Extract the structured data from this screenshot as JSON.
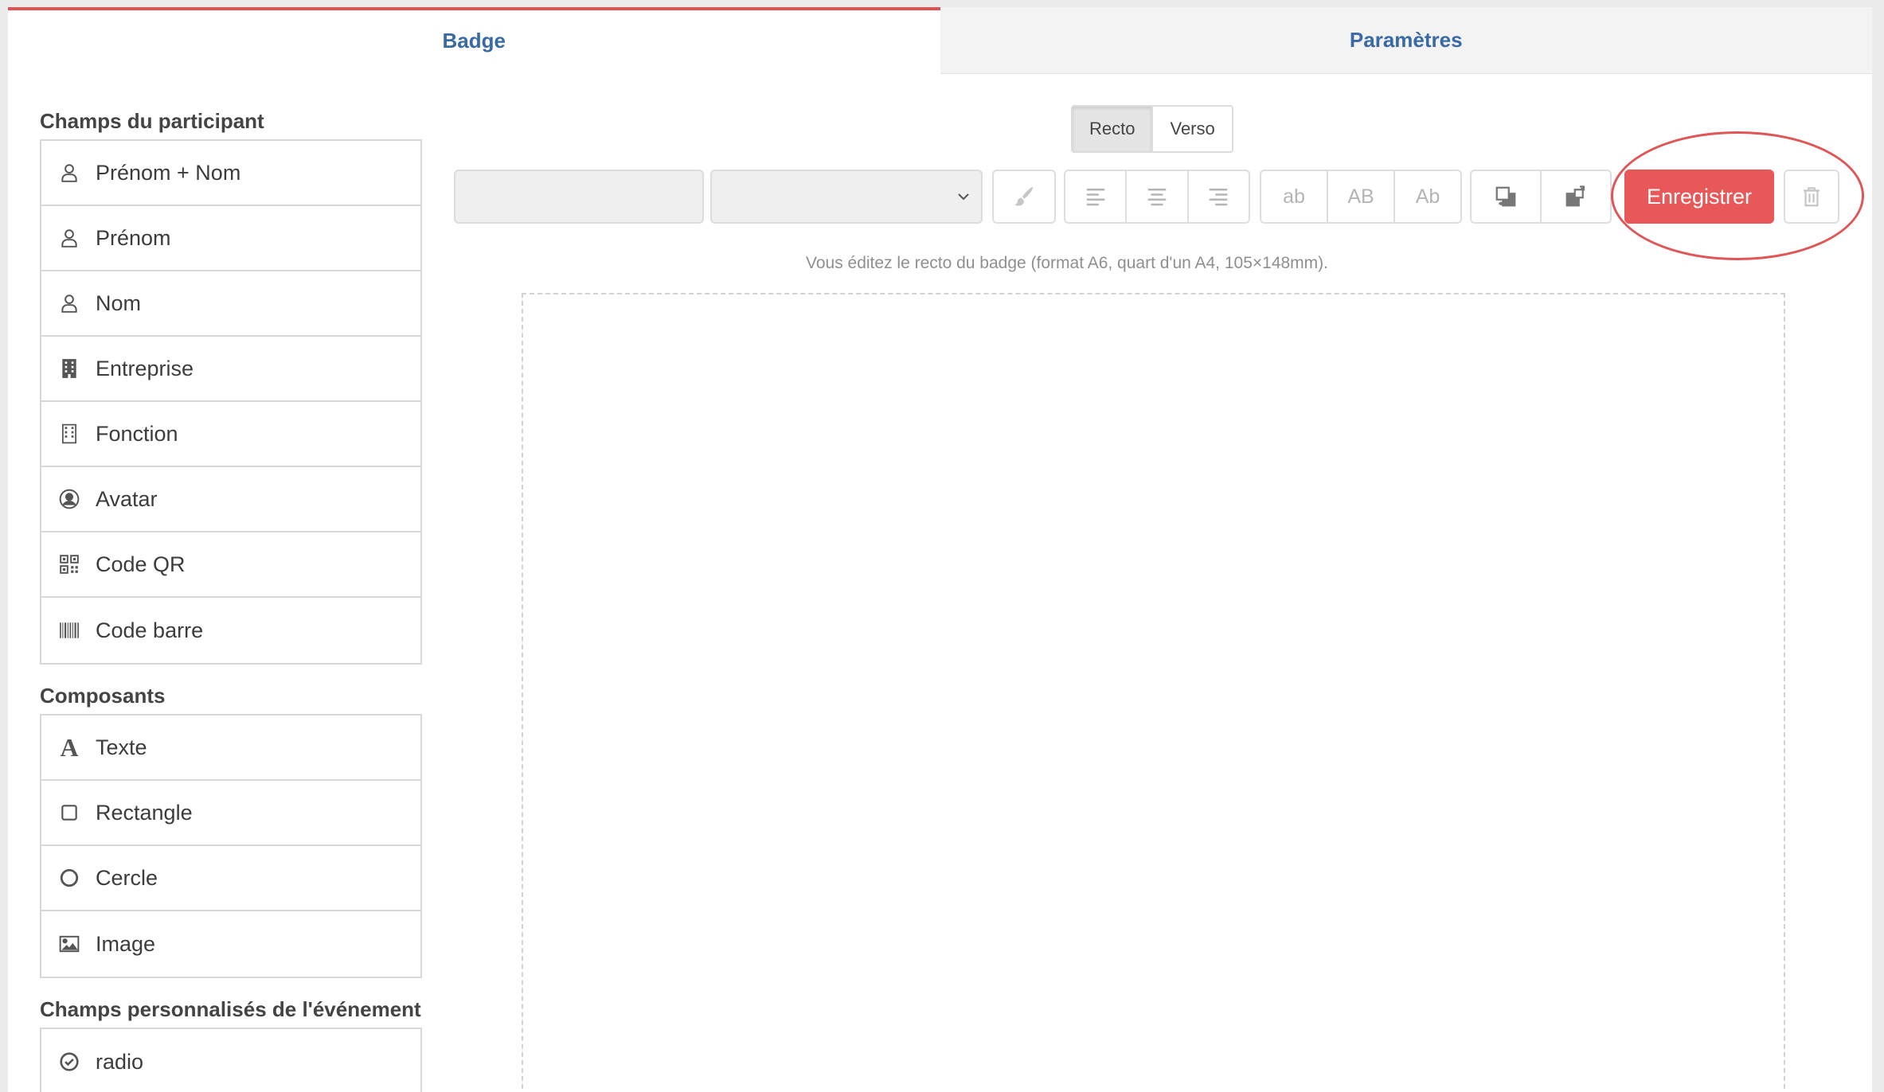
{
  "tabs": [
    {
      "label": "Badge",
      "active": true
    },
    {
      "label": "Paramètres",
      "active": false
    }
  ],
  "sidebar": {
    "participant_title": "Champs du participant",
    "participant_fields": [
      {
        "label": "Prénom + Nom",
        "icon": "user-icon"
      },
      {
        "label": "Prénom",
        "icon": "user-icon"
      },
      {
        "label": "Nom",
        "icon": "user-icon"
      },
      {
        "label": "Entreprise",
        "icon": "building-icon"
      },
      {
        "label": "Fonction",
        "icon": "building-outline-icon"
      },
      {
        "label": "Avatar",
        "icon": "avatar-icon"
      },
      {
        "label": "Code QR",
        "icon": "qrcode-icon"
      },
      {
        "label": "Code barre",
        "icon": "barcode-icon"
      }
    ],
    "components_title": "Composants",
    "components": [
      {
        "label": "Texte",
        "icon": "text-icon"
      },
      {
        "label": "Rectangle",
        "icon": "square-icon"
      },
      {
        "label": "Cercle",
        "icon": "circle-icon"
      },
      {
        "label": "Image",
        "icon": "image-icon"
      }
    ],
    "custom_title": "Champs personnalisés de l'événement",
    "custom_fields": [
      {
        "label": "radio",
        "icon": "check-circle-icon"
      }
    ]
  },
  "editor": {
    "side_toggle": [
      "Recto",
      "Verso"
    ],
    "active_side": "Recto",
    "case_buttons": [
      "ab",
      "AB",
      "Ab"
    ],
    "save_label": "Enregistrer",
    "hint": "Vous éditez le recto du badge (format A6, quart d'un A4, 105×148mm).",
    "accent_color": "#e95858",
    "link_color": "#3a6aa5"
  }
}
